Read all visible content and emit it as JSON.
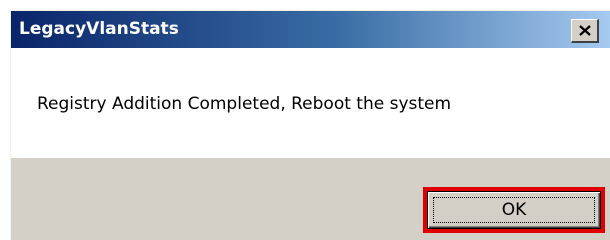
{
  "dialog": {
    "title": "LegacyVlanStats",
    "close_icon": "close-icon",
    "message": "Registry Addition Completed, Reboot the system",
    "ok_label": "OK"
  },
  "colors": {
    "titlebar_start": "#0a246a",
    "titlebar_end": "#a6caf0",
    "dialog_face": "#d4d0c8",
    "highlight": "#e00000"
  }
}
